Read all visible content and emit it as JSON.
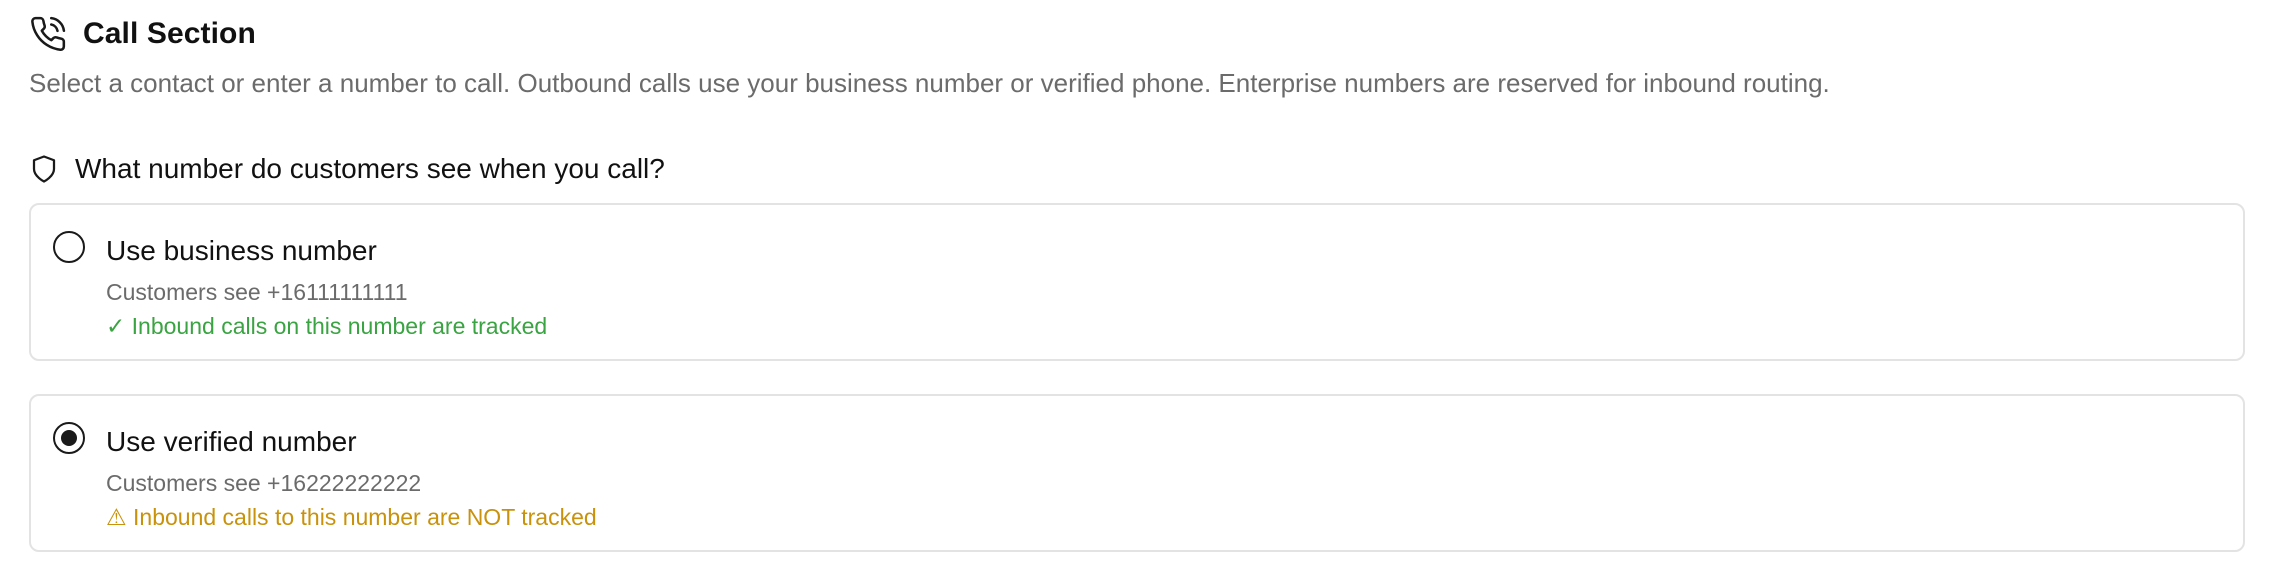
{
  "header": {
    "icon": "phone-call-icon",
    "title": "Call Section",
    "subtitle": "Select a contact or enter a number to call. Outbound calls use your business number or verified phone. Enterprise numbers are reserved for inbound routing."
  },
  "caller_id": {
    "icon": "shield-icon",
    "question": "What number do customers see when you call?",
    "options": [
      {
        "title": "Use business number",
        "subtitle": "Customers see +16111111111",
        "status": "✓ Inbound calls on this number are tracked",
        "selected": false,
        "status_color": "#3aa342"
      },
      {
        "title": "Use verified number",
        "subtitle": "Customers see +16222222222",
        "status": "⚠ Inbound calls to this number are NOT tracked",
        "selected": true,
        "status_color": "#c9920c"
      }
    ]
  }
}
